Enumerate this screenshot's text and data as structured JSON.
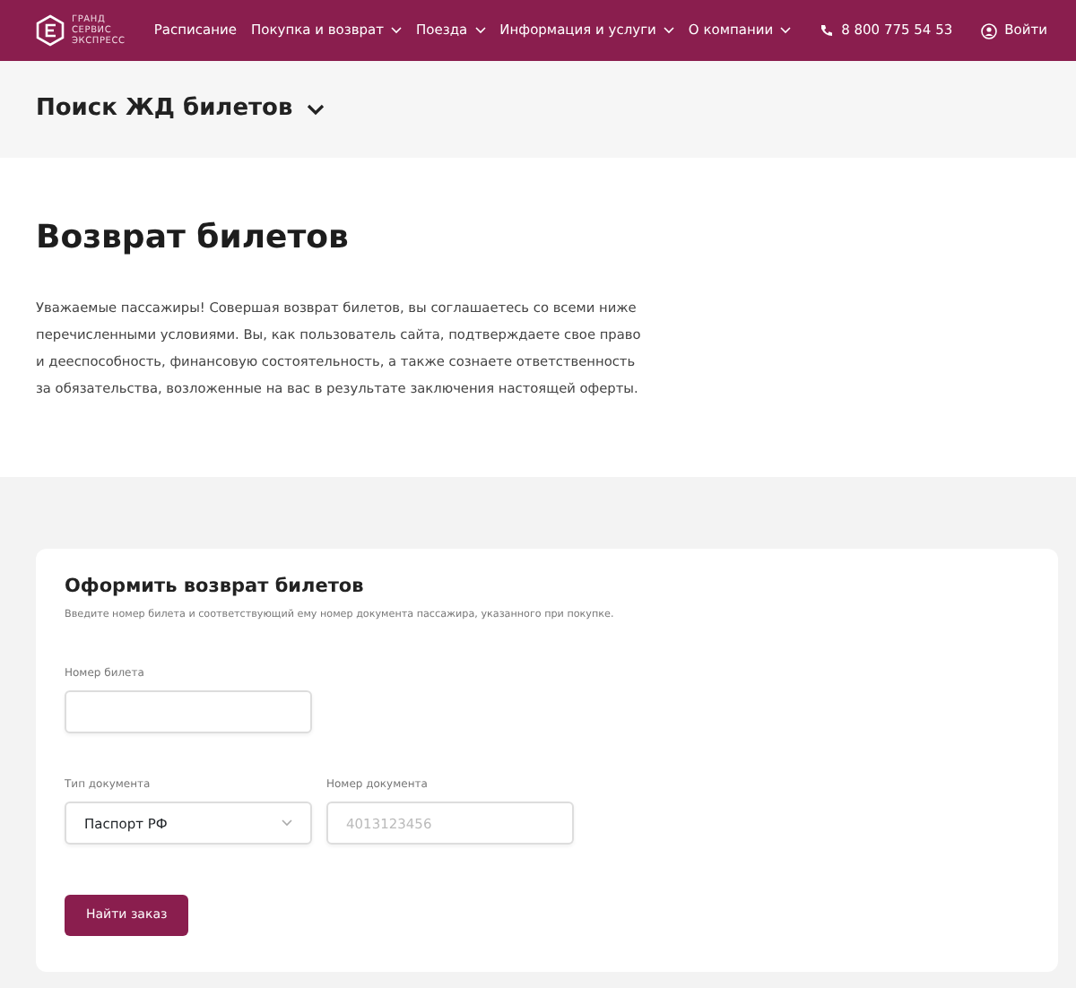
{
  "header": {
    "logo_lines": [
      "ГРАНД",
      "СЕРВИС",
      "ЭКСПРЕСС"
    ],
    "nav": [
      {
        "label": "Расписание",
        "dropdown": false
      },
      {
        "label": "Покупка и возврат",
        "dropdown": true
      },
      {
        "label": "Поезда",
        "dropdown": true
      },
      {
        "label": "Информация и услуги",
        "dropdown": true
      },
      {
        "label": "О компании",
        "dropdown": true
      }
    ],
    "phone": "8 800 775 54 53",
    "login": "Войти"
  },
  "search_bar": {
    "title": "Поиск ЖД билетов"
  },
  "intro": {
    "title": "Возврат билетов",
    "text": "Уважаемые пассажиры! Совершая возврат билетов, вы соглашаетесь со всеми ниже перечисленными условиями. Вы, как пользователь сайта, подтверждаете свое право и дееспособность, финансовую состоятельность, а также сознаете ответственность за обязательства, возложенные на вас в результате заключения настоящей оферты."
  },
  "form": {
    "title": "Оформить возврат билетов",
    "subtitle": "Введите номер билета и соответствующий ему номер документа пассажира, указанного при покупке.",
    "ticket_label": "Номер билета",
    "doc_type_label": "Тип документа",
    "doc_type_value": "Паспорт РФ",
    "doc_number_label": "Номер документа",
    "doc_number_placeholder": "4013123456",
    "submit": "Найти заказ"
  }
}
